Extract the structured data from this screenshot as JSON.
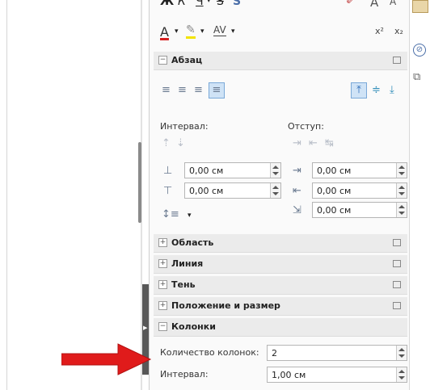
{
  "toolbar": {
    "row1": [
      "Ж",
      "К",
      "Ч",
      "S",
      "A",
      "A"
    ],
    "row2_super": "x²",
    "row2_sub": "x₂",
    "colors": {
      "font": "#d62020",
      "highlight": "#f2e400"
    }
  },
  "sections": {
    "paragraph": "Абзац",
    "area": "Область",
    "line": "Линия",
    "shadow": "Тень",
    "position": "Положение и размер",
    "columns": "Колонки"
  },
  "paragraph": {
    "spacing_label": "Интервал:",
    "indent_label": "Отступ:",
    "spacing_above": "0,00 см",
    "spacing_below": "0,00 см",
    "indent_before": "0,00 см",
    "indent_after": "0,00 см",
    "indent_first": "0,00 см"
  },
  "columns": {
    "count_label": "Количество колонок:",
    "count_value": "2",
    "spacing_label": "Интервал:",
    "spacing_value": "1,00 см"
  },
  "annotation": {
    "arrow_color": "#e01b1b"
  }
}
